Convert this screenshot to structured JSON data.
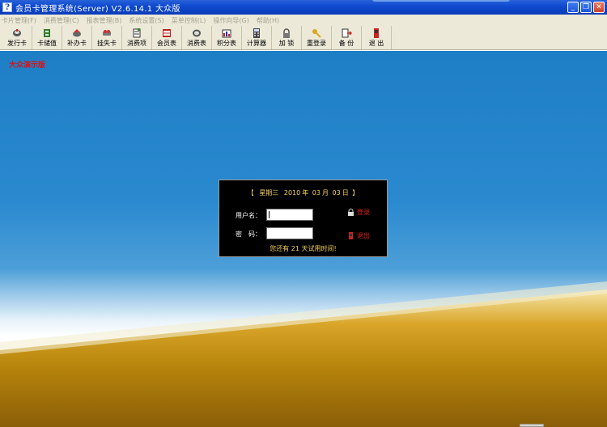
{
  "window": {
    "title": "会员卡管理系统(Server) V2.6.14.1 大众版",
    "app_icon": "?",
    "buttons": {
      "minimize": "_",
      "restore": "❐",
      "close": "✕"
    }
  },
  "menu": [
    "卡片管理(F)",
    "消费管理(C)",
    "报表管理(B)",
    "系统设置(S)",
    "菜单控制(L)",
    "操作向导(G)",
    "帮助(H)"
  ],
  "toolbar": [
    {
      "label": "发行卡",
      "icon": "issue-card-icon"
    },
    {
      "label": "卡储值",
      "icon": "card-recharge-icon"
    },
    {
      "label": "补办卡",
      "icon": "reissue-card-icon"
    },
    {
      "label": "挂失卡",
      "icon": "report-lost-card-icon"
    },
    {
      "label": "消费项",
      "icon": "consumption-item-icon"
    },
    {
      "label": "会员表",
      "icon": "member-table-icon"
    },
    {
      "label": "消费表",
      "icon": "consumption-table-icon"
    },
    {
      "label": "积分表",
      "icon": "points-table-icon"
    },
    {
      "label": "计算器",
      "icon": "calculator-icon"
    },
    {
      "label": "加 锁",
      "icon": "lock-icon"
    },
    {
      "label": "重登录",
      "icon": "relogin-key-icon"
    },
    {
      "label": "备 份",
      "icon": "backup-icon"
    },
    {
      "label": "退 出",
      "icon": "exit-icon"
    }
  ],
  "desktop": {
    "demo_label": "大众演示版"
  },
  "login": {
    "bracket_left": "【",
    "weekday": "星期三",
    "year": "2010",
    "year_unit": "年",
    "month": "03",
    "month_unit": "月",
    "day": "03",
    "day_unit": "日",
    "bracket_right": "】",
    "username_label": "用户名：",
    "username_value": "",
    "password_label": "密　码：",
    "password_value": "",
    "login_label": "登录",
    "exit_label": "退出",
    "trial_text": "您还有 21 天试用时间!"
  },
  "colors": {
    "titlebar": "#0f4ad0",
    "menubar": "#ece9d8",
    "desktop_blue": "#2a89cf",
    "gold": "#c8930a",
    "demo_red": "#e01010",
    "date_yellow": "#f2d15a",
    "action_red": "#e21d1d"
  }
}
